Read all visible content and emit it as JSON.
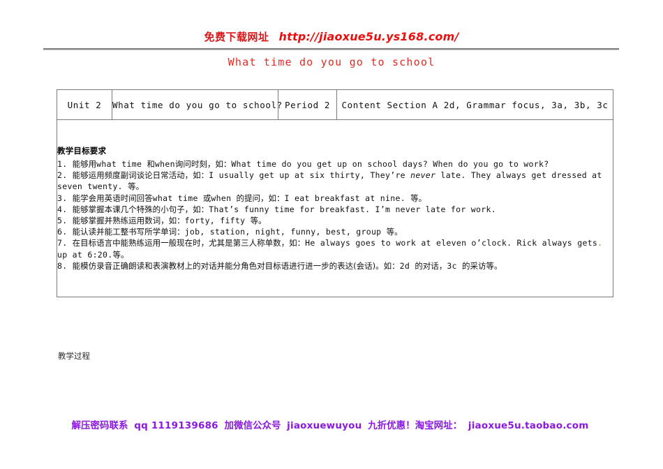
{
  "banner": {
    "cn_text": "免费下载网址",
    "url": "http://jiaoxue5u.ys168.com/",
    "cn_color": "#d8171b",
    "url_color": "#e8110f"
  },
  "doc_title": {
    "text": "What time do you go to school",
    "color": "#e02b25"
  },
  "table": {
    "header": {
      "unit": "Unit 2",
      "topic": "What time do you go to school?",
      "period": "Period 2",
      "content": "Content  Section A  2d, Grammar focus, 3a, 3b, 3c"
    },
    "body": {
      "section_title": "教学目标要求",
      "items": [
        {
          "num": "1.",
          "parts": [
            {
              "t": "能够用",
              "k": "cn"
            },
            {
              "t": "what time ",
              "k": "en"
            },
            {
              "t": "和",
              "k": "cn"
            },
            {
              "t": "when",
              "k": "en"
            },
            {
              "t": "询问时刻，如：",
              "k": "cn"
            },
            {
              "t": "What time do you get up on school days? When do you go to work?",
              "k": "en"
            }
          ]
        },
        {
          "num": "2.",
          "parts": [
            {
              "t": "能够运用频度副词谈论日常活动，如：",
              "k": "cn"
            },
            {
              "t": "I usually get up at six thirty, They’re ",
              "k": "en"
            },
            {
              "t": "never",
              "k": "en-it"
            },
            {
              "t": " late. They always get dressed at seven twenty. ",
              "k": "en"
            },
            {
              "t": "等。",
              "k": "cn"
            }
          ]
        },
        {
          "num": "3.",
          "parts": [
            {
              "t": "能学会用英语时间回答",
              "k": "cn"
            },
            {
              "t": "what time ",
              "k": "en"
            },
            {
              "t": "或",
              "k": "cn"
            },
            {
              "t": "when ",
              "k": "en"
            },
            {
              "t": "的提问，如：",
              "k": "cn"
            },
            {
              "t": "I eat breakfast at nine. ",
              "k": "en"
            },
            {
              "t": "等。",
              "k": "cn"
            }
          ]
        },
        {
          "num": "4.",
          "parts": [
            {
              "t": "能够掌握本课几个特殊的小句子，如：",
              "k": "cn"
            },
            {
              "t": "That’s funny time for breakfast. I’m never late for work.",
              "k": "en"
            }
          ]
        },
        {
          "num": "5.",
          "parts": [
            {
              "t": "能够掌握并熟练运用数词，如：",
              "k": "cn"
            },
            {
              "t": "forty, fifty ",
              "k": "en"
            },
            {
              "t": "等。",
              "k": "cn"
            }
          ]
        },
        {
          "num": "6.",
          "parts": [
            {
              "t": "能认读并能工整书写所学单词：",
              "k": "cn"
            },
            {
              "t": "job, station, night, funny, best, group ",
              "k": "en"
            },
            {
              "t": "等。",
              "k": "cn"
            }
          ]
        },
        {
          "num": "7.",
          "parts": [
            {
              "t": "在目标语言中能熟练运用一般现在时，尤其是第三人称单数，如：",
              "k": "cn"
            },
            {
              "t": "He always goes to work at eleven o’clock. Rick always gets",
              "k": "en"
            },
            {
              "t": ".",
              "k": "mark"
            },
            {
              "t": " up at 6:20.",
              "k": "en"
            },
            {
              "t": "等。",
              "k": "cn"
            }
          ]
        },
        {
          "num": "8.",
          "parts": [
            {
              "t": "能模仿录音正确朗读和表演教材上的对话并能分角色对目标语进行进一步的表达(会话)。如：",
              "k": "cn"
            },
            {
              "t": "2d ",
              "k": "en"
            },
            {
              "t": "的对话，",
              "k": "cn"
            },
            {
              "t": "3c ",
              "k": "en"
            },
            {
              "t": "的采访等。",
              "k": "cn"
            }
          ]
        }
      ]
    }
  },
  "process_label": "教学过程",
  "footer": {
    "color": "#8a1ae0",
    "segments": [
      {
        "t": "解压密码联系",
        "k": "cn"
      },
      {
        "t": "qq 1119139686",
        "k": "lat"
      },
      {
        "t": "加微信公众号",
        "k": "cn"
      },
      {
        "t": "jiaoxuewuyou",
        "k": "lat"
      },
      {
        "t": "九折优惠！淘宝网址：",
        "k": "cn"
      },
      {
        "t": "jiaoxue5u.taobao.com",
        "k": "lat"
      }
    ]
  }
}
